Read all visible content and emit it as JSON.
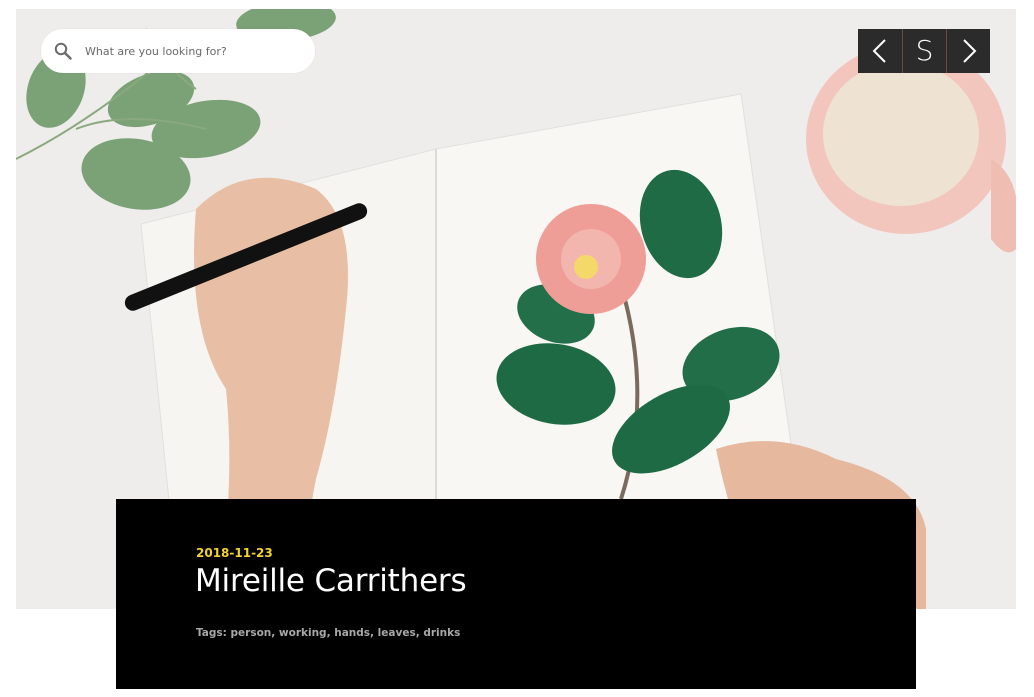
{
  "search": {
    "placeholder": "What are you looking for?",
    "icon": "search-icon"
  },
  "nav": {
    "prev_icon": "chevron-left-icon",
    "middle_label": "S",
    "next_icon": "chevron-right-icon"
  },
  "post": {
    "date": "2018-11-23",
    "title": "Mireille Carrithers",
    "tags_label": "Tags: person, working, hands, leaves, drinks"
  },
  "colors": {
    "date_accent": "#f2d230",
    "caption_bg": "#000000",
    "nav_bg": "#2b2b2b"
  }
}
